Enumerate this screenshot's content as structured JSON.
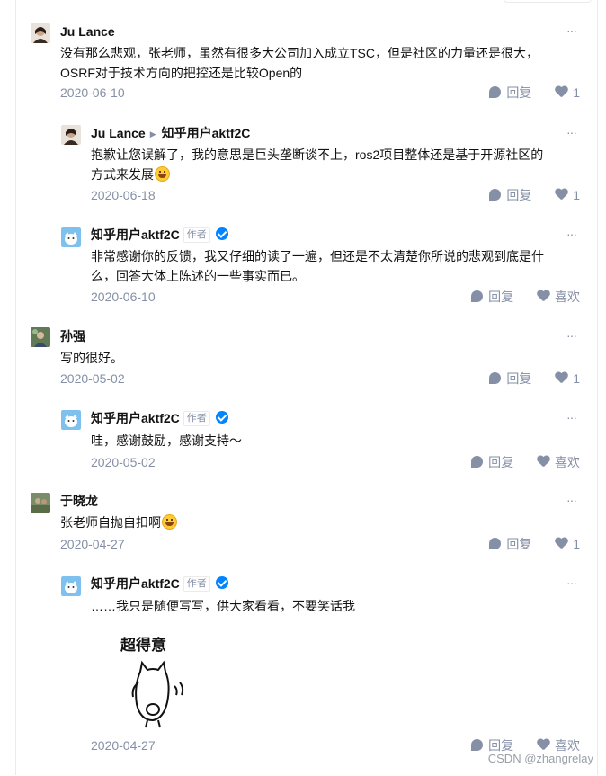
{
  "colors": {
    "meta": "#8590a6",
    "text": "#121212",
    "border": "#ebebeb",
    "verified": "#0084ff"
  },
  "comments": [
    {
      "author": "Ju Lance",
      "text_lines": [
        "没有那么悲观，张老师，虽然有很多大公司加入成立TSC，但是社区的力量还是很大，",
        "OSRF对于技术方向的把控还是比较Open的"
      ],
      "date": "2020-06-10",
      "reply_label": "回复",
      "like_label": "1",
      "more": "···"
    },
    {
      "author": "Ju Lance",
      "reply_to": "知乎用户aktf2C",
      "text_lines": [
        "抱歉让您误解了，我的意思是巨头垄断谈不上，ros2项目整体还是基于开源社区的",
        "方式来发展"
      ],
      "date": "2020-06-18",
      "reply_label": "回复",
      "like_label": "1",
      "more": "···"
    },
    {
      "author": "知乎用户aktf2C",
      "tag": "作者",
      "text_lines": [
        "非常感谢你的反馈，我又仔细的读了一遍，但还是不太清楚你所说的悲观到底是什",
        "么，回答大体上陈述的一些事实而已。"
      ],
      "date": "2020-06-10",
      "reply_label": "回复",
      "like_label": "喜欢",
      "more": "···"
    },
    {
      "author": "孙强",
      "text_lines": [
        "写的很好。"
      ],
      "date": "2020-05-02",
      "reply_label": "回复",
      "like_label": "1",
      "more": "···"
    },
    {
      "author": "知乎用户aktf2C",
      "tag": "作者",
      "text_lines": [
        "哇，感谢鼓励，感谢支持～"
      ],
      "date": "2020-05-02",
      "reply_label": "回复",
      "like_label": "喜欢",
      "more": "···"
    },
    {
      "author": "于晓龙",
      "text_lines": [
        "张老师自抛自扣啊"
      ],
      "date": "2020-04-27",
      "reply_label": "回复",
      "like_label": "1",
      "more": "···"
    },
    {
      "author": "知乎用户aktf2C",
      "tag": "作者",
      "text_lines": [
        "……我只是随便写写，供大家看看，不要笑话我"
      ],
      "sticker_text": "超得意",
      "date": "2020-04-27",
      "reply_label": "回复",
      "like_label": "喜欢",
      "more": "···"
    }
  ],
  "watermark": "CSDN @zhangrelay"
}
